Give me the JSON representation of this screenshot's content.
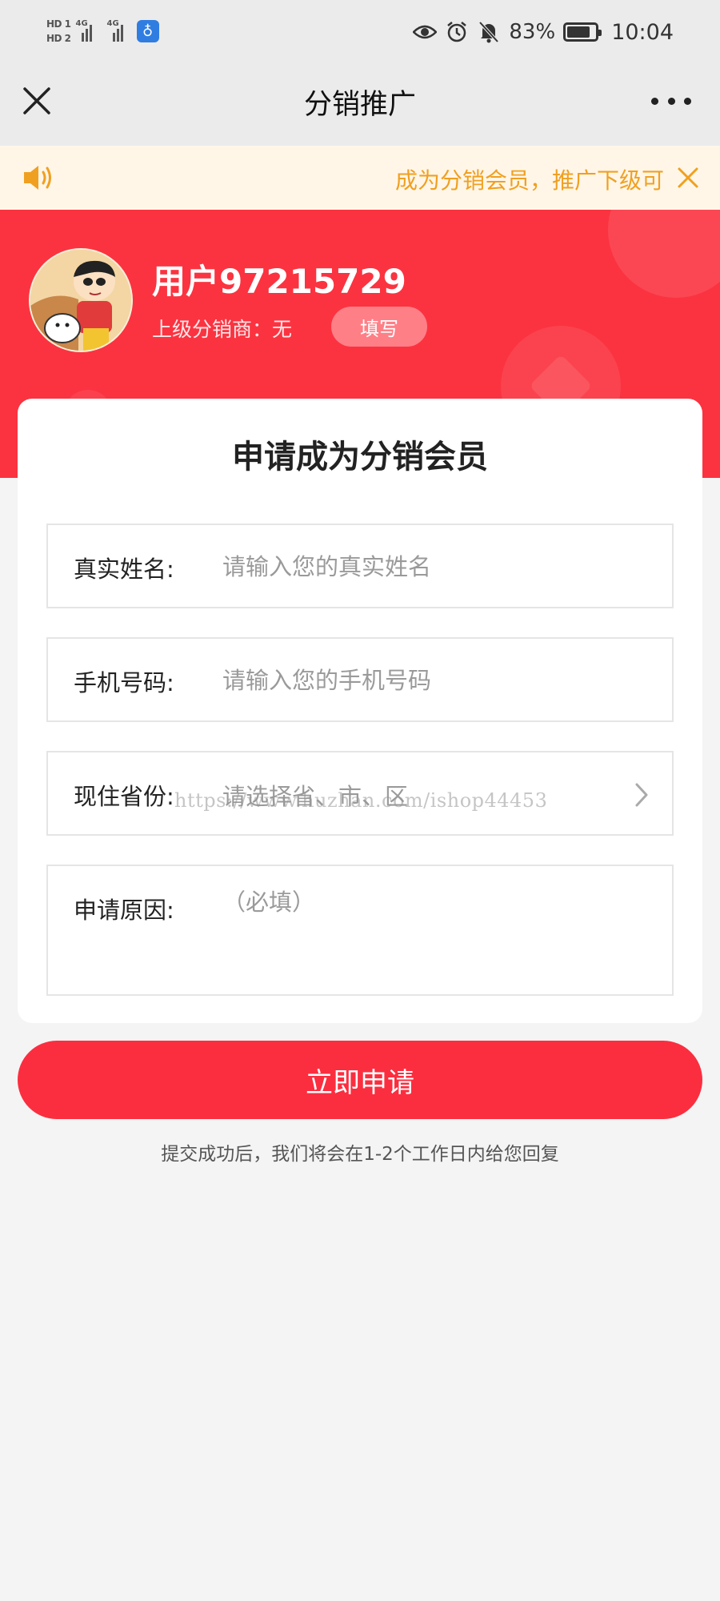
{
  "status_bar": {
    "hd1": "HD 1",
    "hd2": "HD 2",
    "network1": "4G",
    "network2": "4G",
    "battery_percent": "83%",
    "battery_level": 0.83,
    "time": "10:04",
    "icons": [
      "eye-icon",
      "alarm-icon",
      "bell-off-icon",
      "battery-icon"
    ]
  },
  "nav": {
    "title": "分销推广",
    "close_icon": "close-icon",
    "more_icon": "more-icon"
  },
  "notice": {
    "text": "成为分销会员，推广下级可",
    "speaker_icon": "speaker-icon",
    "close_icon": "close-icon",
    "color": "#f0a020",
    "background": "#fff6e8"
  },
  "profile": {
    "username": "用户97215729",
    "superior_label": "上级分销商：无",
    "fill_button": "填写",
    "background": "#fb3340"
  },
  "form": {
    "title": "申请成为分销会员",
    "fields": [
      {
        "label": "真实姓名:",
        "placeholder": "请输入您的真实姓名"
      },
      {
        "label": "手机号码:",
        "placeholder": "请输入您的手机号码"
      },
      {
        "label": "现住省份:",
        "placeholder": "请选择省、市、区"
      },
      {
        "label": "申请原因:",
        "placeholder": "（必填）"
      }
    ]
  },
  "watermark": "https://www.huzhan.com/ishop44453",
  "submit": {
    "label": "立即申请",
    "color": "#fb2e3f"
  },
  "footer_note": "提交成功后，我们将会在1-2个工作日内给您回复"
}
